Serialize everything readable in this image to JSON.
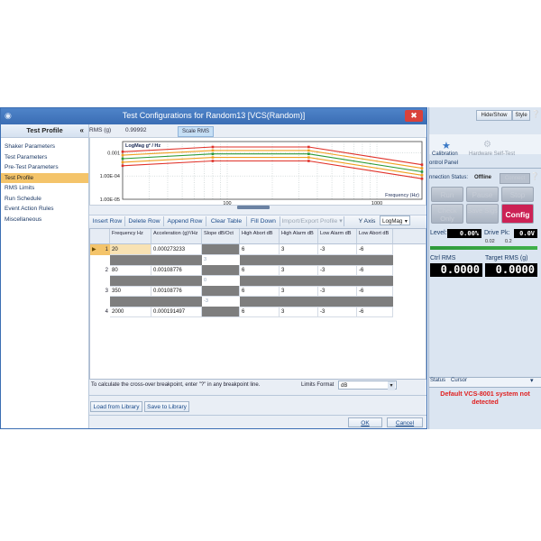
{
  "dialog": {
    "title": "Test Configurations for Random13 [VCS(Random)]",
    "close_label": "✖"
  },
  "leftnav": {
    "header": "Test Profile",
    "collapse": "«",
    "items": [
      {
        "label": "Shaker Parameters"
      },
      {
        "label": "Test Parameters"
      },
      {
        "label": "Pre-Test Parameters"
      },
      {
        "label": "Test Profile"
      },
      {
        "label": "RMS Limits"
      },
      {
        "label": "Run Schedule"
      },
      {
        "label": "Event Action Rules"
      },
      {
        "label": "Miscellaneous"
      }
    ]
  },
  "rms": {
    "label": "RMS (g)",
    "value": "0.99992",
    "scale_button": "Scale RMS"
  },
  "chart_data": {
    "type": "line",
    "title": "LogMag g² / Hz",
    "xlabel": "Frequency (Hz)",
    "x_ticks": [
      "100",
      "1000"
    ],
    "y_ticks": [
      "0.001",
      "1.00E-04",
      "1.00E-05"
    ],
    "x_scale": "log",
    "y_scale": "log",
    "xlim": [
      20,
      2000
    ],
    "ylim": [
      1e-05,
      0.003
    ],
    "grid": true,
    "x": [
      20,
      80,
      350,
      2000
    ],
    "series": [
      {
        "values": [
          0.0011,
          0.00176,
          0.00176,
          0.000305
        ],
        "color": "#e0322a"
      },
      {
        "values": [
          0.00078,
          0.00124,
          0.00124,
          0.000215
        ],
        "color": "#f0a020"
      },
      {
        "values": [
          0.000552,
          0.000882,
          0.000882,
          0.000152
        ],
        "color": "#2e9a35"
      },
      {
        "values": [
          0.00039,
          0.000624,
          0.000624,
          0.000108
        ],
        "color": "#f0a020"
      },
      {
        "values": [
          0.000276,
          0.000441,
          0.000441,
          7.64e-05
        ],
        "color": "#e0322a"
      }
    ]
  },
  "toolbar": {
    "insert_row": "Insert Row",
    "delete_row": "Delete Row",
    "append_row": "Append Row",
    "clear_table": "Clear Table",
    "fill_down": "Fill Down",
    "import_export": "Import/Export Profile",
    "y_axis_label": "Y Axis",
    "y_axis_value": "LogMag"
  },
  "table": {
    "headers": [
      "Frequency Hz",
      "Acceleration (g)²/Hz",
      "Slope dB/Oct",
      "High Abort dB",
      "High Alarm dB",
      "Low Alarm dB",
      "Low Abort dB"
    ],
    "rows": [
      {
        "num": "1",
        "freq": "20",
        "accel": "0.000273233",
        "high_abort": "6",
        "high_alarm": "3",
        "low_alarm": "-3",
        "low_abort": "-6"
      },
      {
        "num": "2",
        "freq": "80",
        "accel": "0.00108776",
        "high_abort": "6",
        "high_alarm": "3",
        "low_alarm": "-3",
        "low_abort": "-6"
      },
      {
        "num": "3",
        "freq": "350",
        "accel": "0.00108776",
        "high_abort": "6",
        "high_alarm": "3",
        "low_alarm": "-3",
        "low_abort": "-6"
      },
      {
        "num": "4",
        "freq": "2000",
        "accel": "0.000191497",
        "high_abort": "6",
        "high_alarm": "3",
        "low_alarm": "-3",
        "low_abort": "-6"
      }
    ],
    "slopes": [
      "3",
      "0",
      "-3"
    ],
    "current_marker": "▶"
  },
  "footer": {
    "hint": "To calculate the cross-over breakpoint, enter \"?\" in any breakpoint line.",
    "limits_format_label": "Limits Format",
    "limits_format_value": "dB",
    "load_library": "Load from Library",
    "save_library": "Save to Library",
    "ok": "OK",
    "cancel": "Cancel"
  },
  "rpanel": {
    "hide_show": "Hide/Show",
    "style": "Style",
    "calibration": "Calibration",
    "hardware_self_test": "Hardware Self-Test",
    "control_panel": "ontrol Panel",
    "connection_label": "nnection Status:",
    "connection_value": "Offline",
    "connect_btn": "Connect",
    "run": "Run",
    "pause": "Pause",
    "stop": "Stop",
    "check_only": "Check Only",
    "save_sigs": "Save Sigs",
    "config": "Config",
    "level_label": "Level:",
    "level_value": "0.00%",
    "drive_label": "Drive Pk:",
    "drive_value": "0.0V",
    "drive_ticks": [
      "0.02",
      "0.2"
    ],
    "ctrl_rms_label": "Ctrl RMS",
    "ctrl_rms_value": "0.0000",
    "target_rms_label": "Target RMS (g)",
    "target_rms_value": "0.0000",
    "tab_status": "Status",
    "tab_cursor": "Cursor",
    "status_message": "Default VCS-8001 system not detected",
    "accent": "#cc2255"
  }
}
